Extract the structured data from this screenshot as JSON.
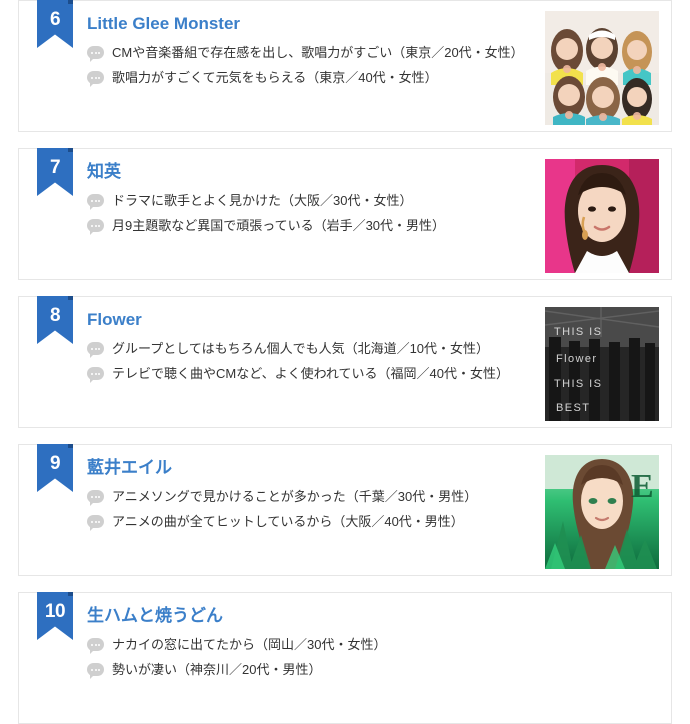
{
  "list": {
    "name": "ranking-list",
    "cards": [
      {
        "rank": "6",
        "title": "Little Glee Monster",
        "comments": [
          "CMや音楽番組で存在感を出し、歌唱力がすごい（東京／20代・女性）",
          "歌唱力がすごくて元気をもらえる（東京／40代・女性）"
        ],
        "thumbnail": "group-photo-six-members",
        "has_thumbnail": true
      },
      {
        "rank": "7",
        "title": "知英",
        "comments": [
          "ドラマに歌手とよく見かけた（大阪／30代・女性）",
          "月9主題歌など異国で頑張っている（岩手／30代・男性）"
        ],
        "thumbnail": "portrait-photo-woman",
        "has_thumbnail": true
      },
      {
        "rank": "8",
        "title": "Flower",
        "comments": [
          "グループとしてはもちろん個人でも人気（北海道／10代・女性）",
          "テレビで聴く曲やCMなど、よく使われている（福岡／40代・女性）"
        ],
        "thumbnail": "album-cover-this-is-flower-this-is-best",
        "has_thumbnail": true
      },
      {
        "rank": "9",
        "title": "藍井エイル",
        "comments": [
          "アニメソングで見かけることが多かった（千葉／30代・男性）",
          "アニメの曲が全てヒットしているから（大阪／40代・男性）"
        ],
        "thumbnail": "album-cover-green-portrait",
        "has_thumbnail": true
      },
      {
        "rank": "10",
        "title": "生ハムと焼うどん",
        "comments": [
          "ナカイの窓に出てたから（岡山／30代・女性）",
          "勢いが凄い（神奈川／20代・男性）"
        ],
        "thumbnail": "",
        "has_thumbnail": false
      }
    ]
  },
  "colors": {
    "ribbon": "#2e6fc0",
    "ribbon_fold": "#1c4d8c",
    "title": "#3b7fc9",
    "comment_text": "#333333",
    "card_border": "#e6e6e6",
    "bubble_icon": "#cfcfcf",
    "page_background": "#ffffff"
  }
}
